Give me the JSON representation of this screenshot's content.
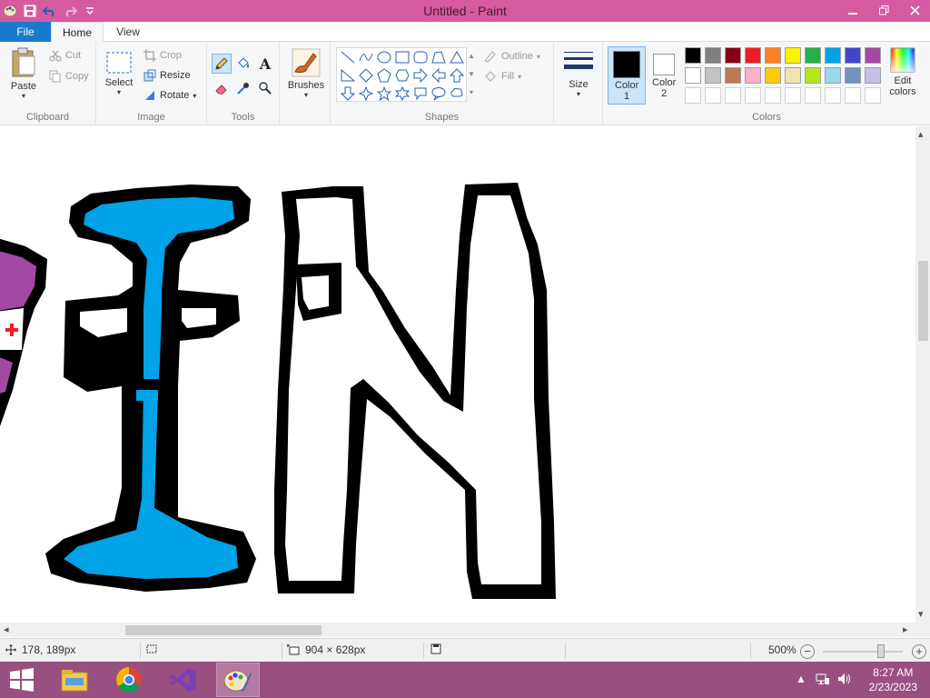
{
  "window": {
    "title": "Untitled - Paint"
  },
  "tabs": {
    "file": "File",
    "home": "Home",
    "view": "View"
  },
  "clipboard": {
    "paste": "Paste",
    "cut": "Cut",
    "copy": "Copy",
    "label": "Clipboard"
  },
  "image": {
    "select": "Select",
    "crop": "Crop",
    "resize": "Resize",
    "rotate": "Rotate",
    "label": "Image"
  },
  "tools": {
    "label": "Tools",
    "text_glyph": "A"
  },
  "brushes": {
    "label": "Brushes"
  },
  "shapes": {
    "outline": "Outline",
    "fill": "Fill",
    "label": "Shapes"
  },
  "size": {
    "label": "Size"
  },
  "colors": {
    "color1": "Color 1",
    "color2": "Color 2",
    "edit": "Edit colors",
    "label": "Colors",
    "color1_value": "#000000",
    "color2_value": "#ffffff",
    "palette_row1": [
      "#000000",
      "#7f7f7f",
      "#880015",
      "#ed1c24",
      "#ff7f27",
      "#fff200",
      "#22b14c",
      "#00a2e8",
      "#3f48cc",
      "#a349a4"
    ],
    "palette_row2": [
      "#ffffff",
      "#c3c3c3",
      "#b97a57",
      "#ffaec9",
      "#ffc90e",
      "#efe4b0",
      "#b5e61d",
      "#99d9ea",
      "#7092be",
      "#c8bfe7"
    ]
  },
  "drawing": {
    "fill_blue": "#00a2e8",
    "fill_purple": "#a349a4",
    "mark_red": "#ed1c24"
  },
  "status": {
    "cursor": "178, 189px",
    "canvas_size": "904 × 628px",
    "zoom": "500%"
  },
  "taskbar": {
    "time": "8:27 AM",
    "date": "2/23/2023"
  },
  "icons": [
    "paint-app-icon",
    "save-icon",
    "undo-icon",
    "redo-icon",
    "paste-icon",
    "scissors-icon",
    "copy-icon",
    "select-icon",
    "crop-icon",
    "resize-icon",
    "rotate-icon",
    "pencil-icon",
    "fill-bucket-icon",
    "text-icon",
    "eraser-icon",
    "color-picker-icon",
    "magnifier-icon",
    "brush-icon",
    "size-lines-icon",
    "edit-colors-icon",
    "move-cursor-icon",
    "selection-icon",
    "canvas-size-icon",
    "disk-icon",
    "windows-start-icon",
    "file-explorer-icon",
    "chrome-icon",
    "visual-studio-icon",
    "paint-taskbar-icon"
  ]
}
